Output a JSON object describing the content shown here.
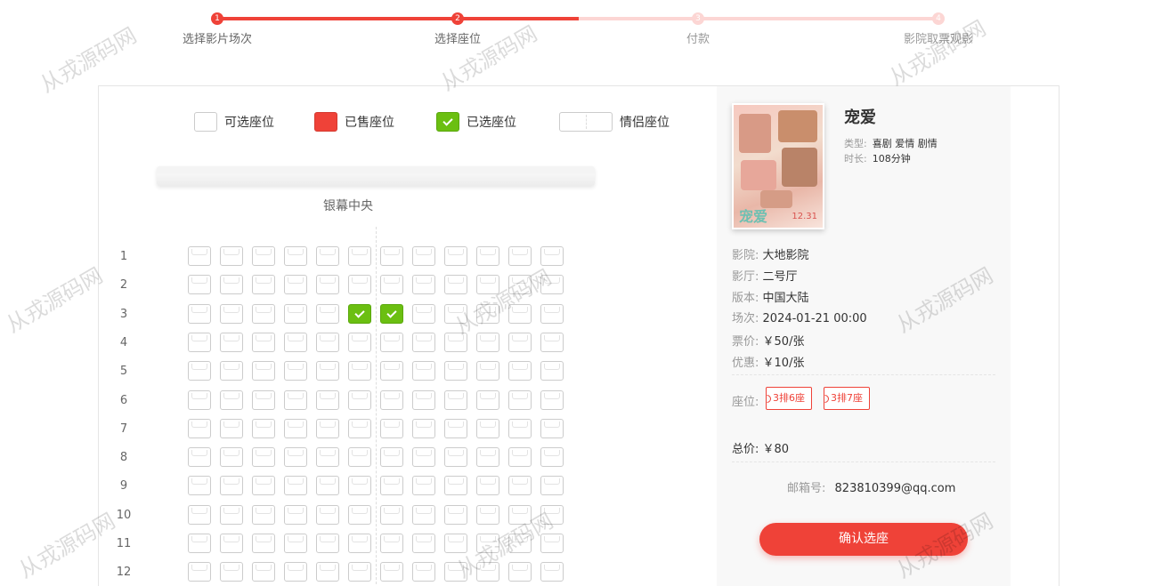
{
  "steps": [
    {
      "num": "1",
      "label": "选择影片场次",
      "state": "done"
    },
    {
      "num": "2",
      "label": "选择座位",
      "state": "done"
    },
    {
      "num": "3",
      "label": "付款",
      "state": "todo"
    },
    {
      "num": "4",
      "label": "影院取票观影",
      "state": "todo"
    }
  ],
  "legend": {
    "available": "可选座位",
    "sold": "已售座位",
    "selected": "已选座位",
    "couple": "情侣座位"
  },
  "screen_label": "银幕中央",
  "rows": [
    "1",
    "2",
    "3",
    "4",
    "5",
    "6",
    "7",
    "8",
    "9",
    "10",
    "11",
    "12"
  ],
  "seats_per_row": 12,
  "selected_seats": [
    {
      "row": 3,
      "col": 6
    },
    {
      "row": 3,
      "col": 7
    }
  ],
  "movie": {
    "title": "宠爱",
    "genre_label": "类型:",
    "genre": "喜剧 爱情 剧情",
    "duration_label": "时长:",
    "duration": "108分钟",
    "poster_title": "宠爱",
    "poster_date": "12.31"
  },
  "info": {
    "cinema_label": "影院:",
    "cinema": "大地影院",
    "hall_label": "影厅:",
    "hall": "二号厅",
    "version_label": "版本:",
    "version": "中国大陆",
    "showtime_label": "场次:",
    "showtime": "2024-01-21 00:00",
    "price_label": "票价:",
    "price": "￥50/张",
    "discount_label": "优惠:",
    "discount": "￥10/张",
    "seats_label": "座位:",
    "seat_tags": [
      "3排6座",
      "3排7座"
    ],
    "total_label": "总价:",
    "total": "￥80",
    "email_label": "邮箱号:",
    "email": "823810399@qq.com"
  },
  "confirm_button": "确认选座",
  "watermark": "从戎源码网",
  "colors": {
    "accent": "#ef4238",
    "accent_light": "#fcd6d4",
    "selected": "#6bbf11"
  }
}
